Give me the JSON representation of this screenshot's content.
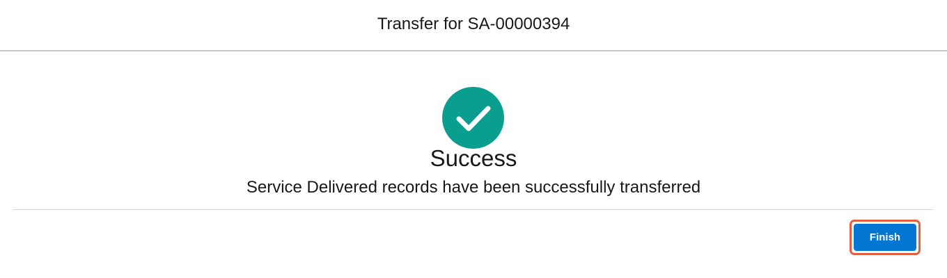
{
  "modal": {
    "title": "Transfer for SA-00000394"
  },
  "result": {
    "icon": "checkmark-icon",
    "heading": "Success",
    "message": "Service Delivered records have been successfully transferred"
  },
  "footer": {
    "finish_label": "Finish"
  },
  "colors": {
    "success": "#0a9e8f",
    "brand": "#0176d3",
    "focus_ring": "#e2603f"
  }
}
